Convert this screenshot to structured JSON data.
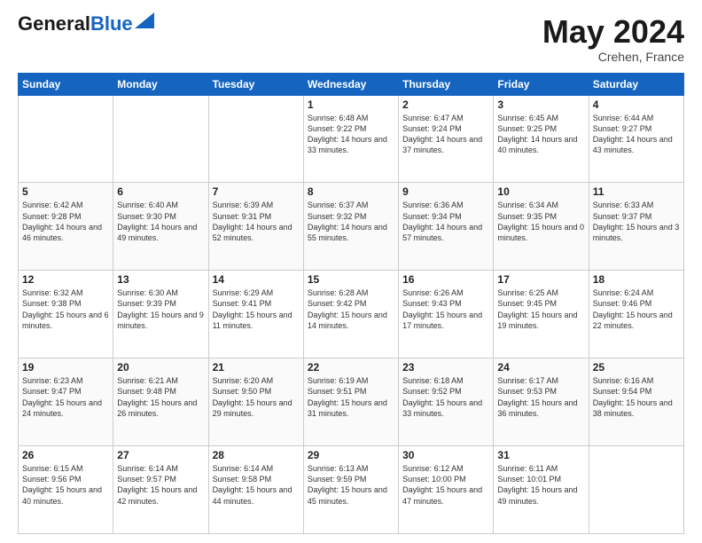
{
  "header": {
    "logo_general": "General",
    "logo_blue": "Blue",
    "month_title": "May 2024",
    "location": "Crehen, France"
  },
  "weekdays": [
    "Sunday",
    "Monday",
    "Tuesday",
    "Wednesday",
    "Thursday",
    "Friday",
    "Saturday"
  ],
  "weeks": [
    [
      {
        "day": "",
        "sunrise": "",
        "sunset": "",
        "daylight": ""
      },
      {
        "day": "",
        "sunrise": "",
        "sunset": "",
        "daylight": ""
      },
      {
        "day": "",
        "sunrise": "",
        "sunset": "",
        "daylight": ""
      },
      {
        "day": "1",
        "sunrise": "Sunrise: 6:48 AM",
        "sunset": "Sunset: 9:22 PM",
        "daylight": "Daylight: 14 hours and 33 minutes."
      },
      {
        "day": "2",
        "sunrise": "Sunrise: 6:47 AM",
        "sunset": "Sunset: 9:24 PM",
        "daylight": "Daylight: 14 hours and 37 minutes."
      },
      {
        "day": "3",
        "sunrise": "Sunrise: 6:45 AM",
        "sunset": "Sunset: 9:25 PM",
        "daylight": "Daylight: 14 hours and 40 minutes."
      },
      {
        "day": "4",
        "sunrise": "Sunrise: 6:44 AM",
        "sunset": "Sunset: 9:27 PM",
        "daylight": "Daylight: 14 hours and 43 minutes."
      }
    ],
    [
      {
        "day": "5",
        "sunrise": "Sunrise: 6:42 AM",
        "sunset": "Sunset: 9:28 PM",
        "daylight": "Daylight: 14 hours and 46 minutes."
      },
      {
        "day": "6",
        "sunrise": "Sunrise: 6:40 AM",
        "sunset": "Sunset: 9:30 PM",
        "daylight": "Daylight: 14 hours and 49 minutes."
      },
      {
        "day": "7",
        "sunrise": "Sunrise: 6:39 AM",
        "sunset": "Sunset: 9:31 PM",
        "daylight": "Daylight: 14 hours and 52 minutes."
      },
      {
        "day": "8",
        "sunrise": "Sunrise: 6:37 AM",
        "sunset": "Sunset: 9:32 PM",
        "daylight": "Daylight: 14 hours and 55 minutes."
      },
      {
        "day": "9",
        "sunrise": "Sunrise: 6:36 AM",
        "sunset": "Sunset: 9:34 PM",
        "daylight": "Daylight: 14 hours and 57 minutes."
      },
      {
        "day": "10",
        "sunrise": "Sunrise: 6:34 AM",
        "sunset": "Sunset: 9:35 PM",
        "daylight": "Daylight: 15 hours and 0 minutes."
      },
      {
        "day": "11",
        "sunrise": "Sunrise: 6:33 AM",
        "sunset": "Sunset: 9:37 PM",
        "daylight": "Daylight: 15 hours and 3 minutes."
      }
    ],
    [
      {
        "day": "12",
        "sunrise": "Sunrise: 6:32 AM",
        "sunset": "Sunset: 9:38 PM",
        "daylight": "Daylight: 15 hours and 6 minutes."
      },
      {
        "day": "13",
        "sunrise": "Sunrise: 6:30 AM",
        "sunset": "Sunset: 9:39 PM",
        "daylight": "Daylight: 15 hours and 9 minutes."
      },
      {
        "day": "14",
        "sunrise": "Sunrise: 6:29 AM",
        "sunset": "Sunset: 9:41 PM",
        "daylight": "Daylight: 15 hours and 11 minutes."
      },
      {
        "day": "15",
        "sunrise": "Sunrise: 6:28 AM",
        "sunset": "Sunset: 9:42 PM",
        "daylight": "Daylight: 15 hours and 14 minutes."
      },
      {
        "day": "16",
        "sunrise": "Sunrise: 6:26 AM",
        "sunset": "Sunset: 9:43 PM",
        "daylight": "Daylight: 15 hours and 17 minutes."
      },
      {
        "day": "17",
        "sunrise": "Sunrise: 6:25 AM",
        "sunset": "Sunset: 9:45 PM",
        "daylight": "Daylight: 15 hours and 19 minutes."
      },
      {
        "day": "18",
        "sunrise": "Sunrise: 6:24 AM",
        "sunset": "Sunset: 9:46 PM",
        "daylight": "Daylight: 15 hours and 22 minutes."
      }
    ],
    [
      {
        "day": "19",
        "sunrise": "Sunrise: 6:23 AM",
        "sunset": "Sunset: 9:47 PM",
        "daylight": "Daylight: 15 hours and 24 minutes."
      },
      {
        "day": "20",
        "sunrise": "Sunrise: 6:21 AM",
        "sunset": "Sunset: 9:48 PM",
        "daylight": "Daylight: 15 hours and 26 minutes."
      },
      {
        "day": "21",
        "sunrise": "Sunrise: 6:20 AM",
        "sunset": "Sunset: 9:50 PM",
        "daylight": "Daylight: 15 hours and 29 minutes."
      },
      {
        "day": "22",
        "sunrise": "Sunrise: 6:19 AM",
        "sunset": "Sunset: 9:51 PM",
        "daylight": "Daylight: 15 hours and 31 minutes."
      },
      {
        "day": "23",
        "sunrise": "Sunrise: 6:18 AM",
        "sunset": "Sunset: 9:52 PM",
        "daylight": "Daylight: 15 hours and 33 minutes."
      },
      {
        "day": "24",
        "sunrise": "Sunrise: 6:17 AM",
        "sunset": "Sunset: 9:53 PM",
        "daylight": "Daylight: 15 hours and 36 minutes."
      },
      {
        "day": "25",
        "sunrise": "Sunrise: 6:16 AM",
        "sunset": "Sunset: 9:54 PM",
        "daylight": "Daylight: 15 hours and 38 minutes."
      }
    ],
    [
      {
        "day": "26",
        "sunrise": "Sunrise: 6:15 AM",
        "sunset": "Sunset: 9:56 PM",
        "daylight": "Daylight: 15 hours and 40 minutes."
      },
      {
        "day": "27",
        "sunrise": "Sunrise: 6:14 AM",
        "sunset": "Sunset: 9:57 PM",
        "daylight": "Daylight: 15 hours and 42 minutes."
      },
      {
        "day": "28",
        "sunrise": "Sunrise: 6:14 AM",
        "sunset": "Sunset: 9:58 PM",
        "daylight": "Daylight: 15 hours and 44 minutes."
      },
      {
        "day": "29",
        "sunrise": "Sunrise: 6:13 AM",
        "sunset": "Sunset: 9:59 PM",
        "daylight": "Daylight: 15 hours and 45 minutes."
      },
      {
        "day": "30",
        "sunrise": "Sunrise: 6:12 AM",
        "sunset": "Sunset: 10:00 PM",
        "daylight": "Daylight: 15 hours and 47 minutes."
      },
      {
        "day": "31",
        "sunrise": "Sunrise: 6:11 AM",
        "sunset": "Sunset: 10:01 PM",
        "daylight": "Daylight: 15 hours and 49 minutes."
      },
      {
        "day": "",
        "sunrise": "",
        "sunset": "",
        "daylight": ""
      }
    ]
  ]
}
